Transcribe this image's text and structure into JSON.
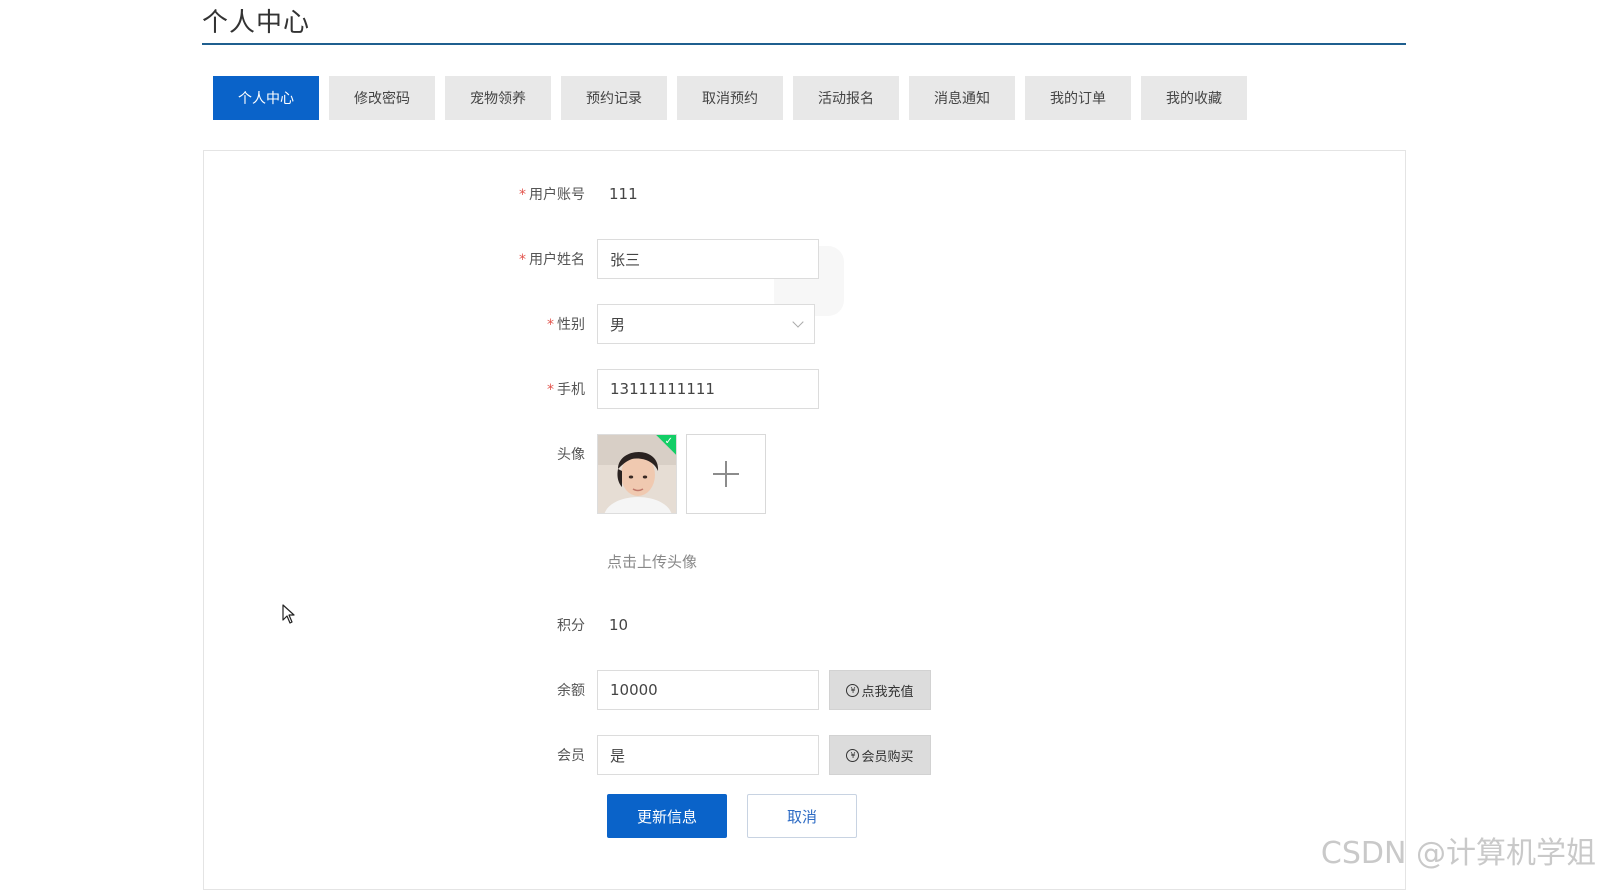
{
  "header": {
    "title": "个人中心"
  },
  "tabs": [
    {
      "label": "个人中心",
      "active": true
    },
    {
      "label": "修改密码",
      "active": false
    },
    {
      "label": "宠物领养",
      "active": false
    },
    {
      "label": "预约记录",
      "active": false
    },
    {
      "label": "取消预约",
      "active": false
    },
    {
      "label": "活动报名",
      "active": false
    },
    {
      "label": "消息通知",
      "active": false
    },
    {
      "label": "我的订单",
      "active": false
    },
    {
      "label": "我的收藏",
      "active": false
    }
  ],
  "form": {
    "account": {
      "label": "用户账号",
      "value": "111",
      "required": true
    },
    "name": {
      "label": "用户姓名",
      "value": "张三",
      "required": true
    },
    "gender": {
      "label": "性别",
      "value": "男",
      "required": true
    },
    "phone": {
      "label": "手机",
      "value": "13111111111",
      "required": true
    },
    "avatar": {
      "label": "头像",
      "upload_tip": "点击上传头像"
    },
    "points": {
      "label": "积分",
      "value": "10"
    },
    "balance": {
      "label": "余额",
      "value": "10000",
      "button_label": "点我充值"
    },
    "member": {
      "label": "会员",
      "value": "是",
      "button_label": "会员购买"
    },
    "submit_label": "更新信息",
    "cancel_label": "取消"
  },
  "icons": {
    "gender_select": "chevron-down-icon",
    "upload": "plus-icon",
    "avatar_ok": "check-icon",
    "recharge": "coin-icon",
    "member_buy": "coin-icon",
    "cursor": "mouse-pointer-icon"
  },
  "colors": {
    "primary": "#0a63c9",
    "title_rule": "#1f5f8f",
    "required_star": "#e2534c",
    "success": "#13ce66"
  },
  "watermark": "CSDN @计算机学姐"
}
